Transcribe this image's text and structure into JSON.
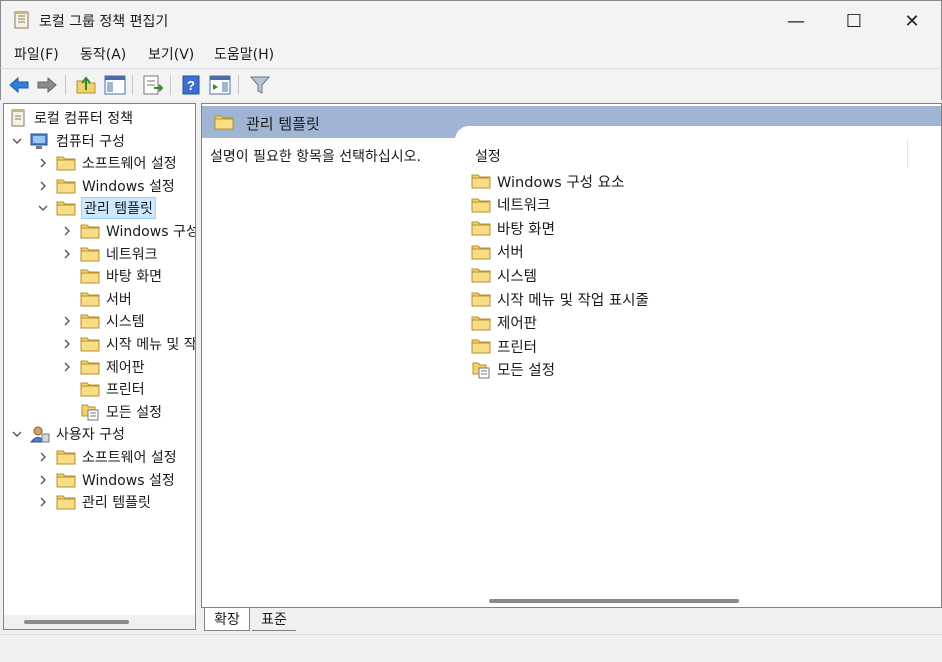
{
  "window": {
    "title": "로컬 그룹 정책 편집기",
    "minimize_glyph": "—",
    "maximize_glyph": "☐",
    "close_glyph": "✕"
  },
  "menu": [
    {
      "label": "파일(F)"
    },
    {
      "label": "동작(A)"
    },
    {
      "label": "보기(V)"
    },
    {
      "label": "도움말(H)"
    }
  ],
  "toolbar": {
    "icons": [
      "back-arrow-icon",
      "forward-arrow-icon",
      "up-folder-icon",
      "show-hide-tree-icon",
      "export-list-icon",
      "help-icon",
      "show-hide-action-pane-icon",
      "filter-icon"
    ]
  },
  "tree": {
    "root": "로컬 컴퓨터 정책",
    "computer": "컴퓨터 구성",
    "computer_children": [
      "소프트웨어 설정",
      "Windows 설정",
      "관리 템플릿"
    ],
    "admin_children": [
      "Windows 구성 요소",
      "네트워크",
      "바탕 화면",
      "서버",
      "시스템",
      "시작 메뉴 및 작업 표시줄",
      "제어판",
      "프린터",
      "모든 설정"
    ],
    "user": "사용자 구성",
    "user_children": [
      "소프트웨어 설정",
      "Windows 설정",
      "관리 템플릿"
    ]
  },
  "right": {
    "header": "관리 템플릿",
    "description": "설명이 필요한 항목을 선택하십시오.",
    "column": "설정",
    "items": [
      "Windows 구성 요소",
      "네트워크",
      "바탕 화면",
      "서버",
      "시스템",
      "시작 메뉴 및 작업 표시줄",
      "제어판",
      "프린터",
      "모든 설정"
    ]
  },
  "tabs": {
    "extended": "확장",
    "standard": "표준"
  },
  "colors": {
    "header_bg": "#9fb5d3",
    "selection": "#cce8ff",
    "folder": "#f4d06f"
  }
}
